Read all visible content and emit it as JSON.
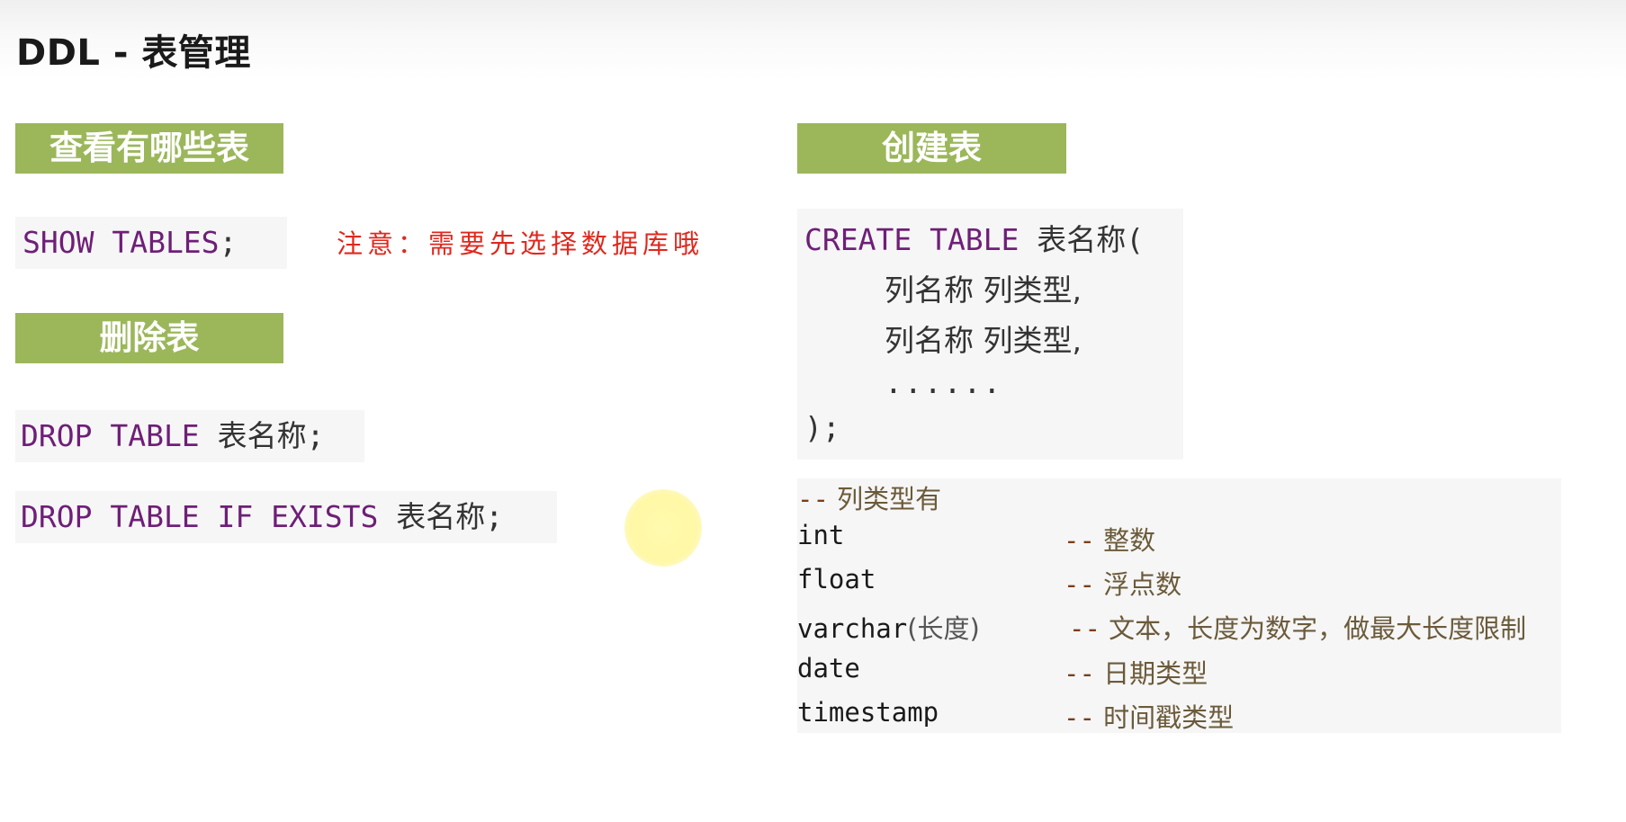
{
  "title": "DDL - 表管理",
  "sections": {
    "show": {
      "label": "查看有哪些表",
      "code": {
        "kw": "SHOW TABLES",
        "end": ";"
      },
      "note": "注意：需要先选择数据库哦"
    },
    "drop": {
      "label": "删除表",
      "line1": {
        "kw": "DROP TABLE",
        "name": "表名称",
        "end": ";"
      },
      "line2": {
        "kw": "DROP TABLE IF EXISTS",
        "name": "表名称",
        "end": ";"
      }
    },
    "create": {
      "label": "创建表",
      "head": {
        "kw": "CREATE TABLE",
        "name": "表名称",
        "open": "("
      },
      "col1": "列名称 列类型,",
      "col2": "列名称 列类型,",
      "ellipsis": "......",
      "close": ");"
    }
  },
  "types": {
    "header": {
      "dash": "--",
      "text": "列类型有"
    },
    "rows": [
      {
        "name": "int",
        "comment": "整数"
      },
      {
        "name": "float",
        "comment": "浮点数"
      },
      {
        "name": "varchar",
        "arg": "(长度)",
        "comment": "文本，长度为数字，做最大长度限制"
      },
      {
        "name": "date",
        "comment": "日期类型"
      },
      {
        "name": "timestamp",
        "comment": "时间戳类型"
      }
    ],
    "dash": "--"
  }
}
